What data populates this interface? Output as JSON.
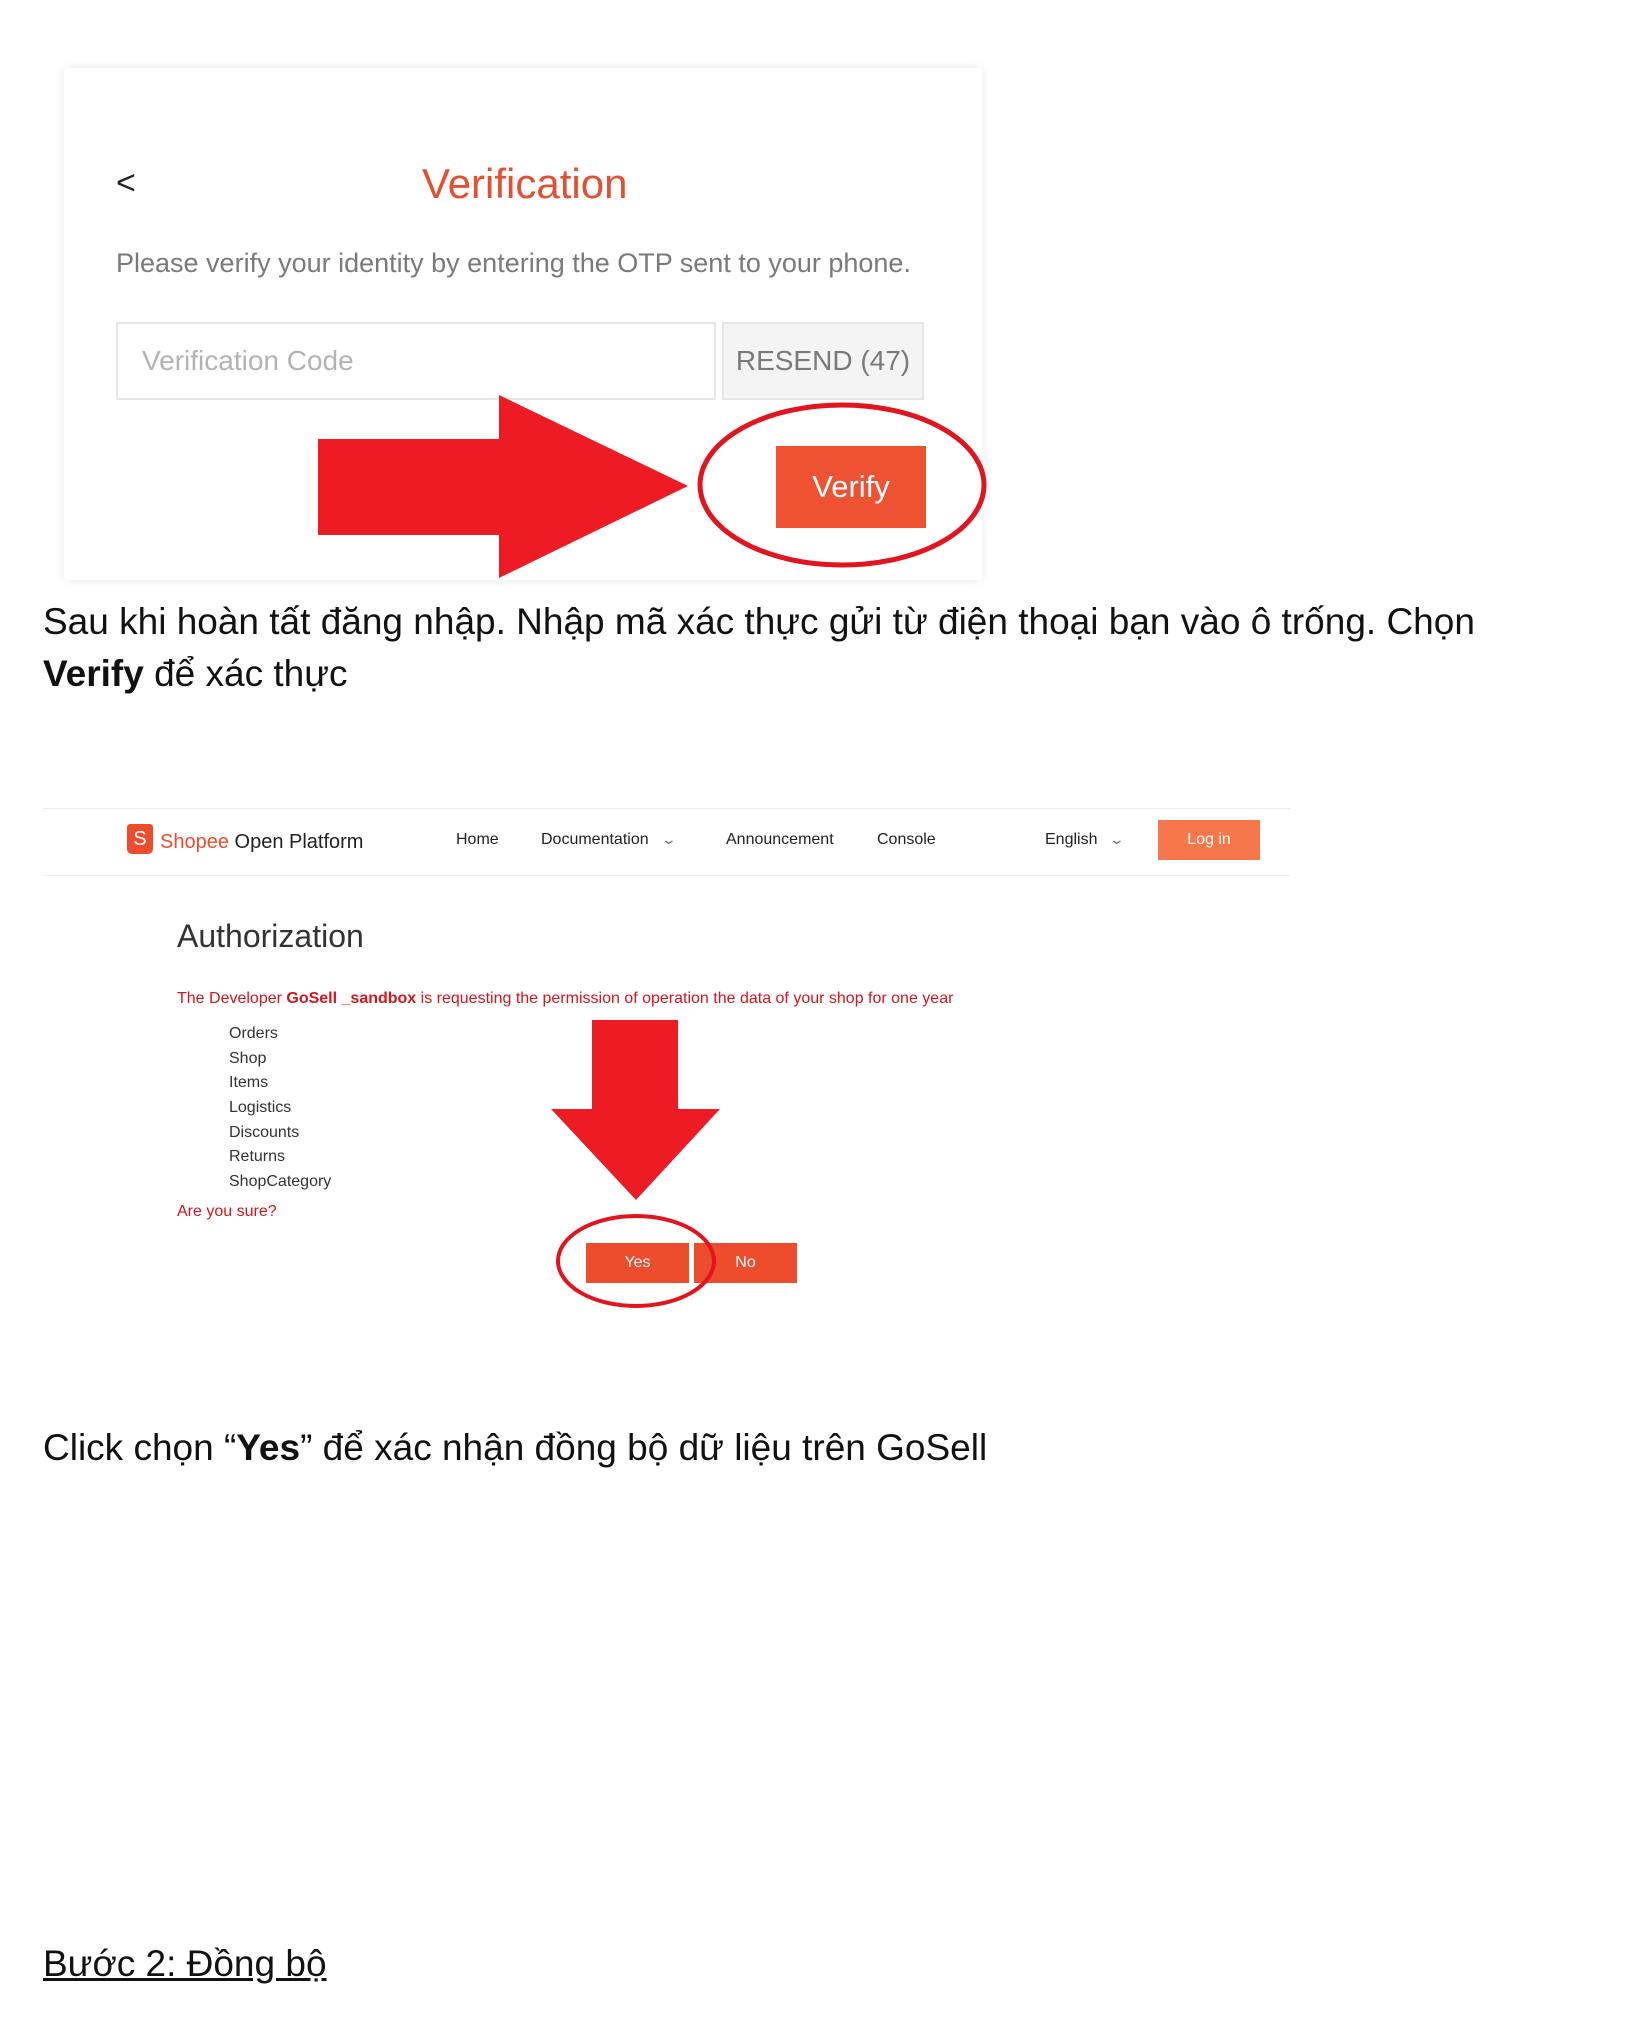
{
  "verification": {
    "back_icon": "<",
    "title": "Verification",
    "description": "Please verify your identity by entering the OTP sent to your phone.",
    "code_placeholder": "Verification Code",
    "resend_label": "RESEND (47)",
    "verify_label": "Verify",
    "accent_color": "#ef5233"
  },
  "caption1": {
    "text_before": "Sau khi hoàn tất đăng nhập. Nhập mã xác thực gửi từ điện thoại bạn vào ô trống. Chọn",
    "bold": "Verify",
    "text_after": " để xác thực"
  },
  "shopee": {
    "logo_letter": "S",
    "brand_name": "Shopee",
    "brand_suffix": " Open Platform",
    "nav": [
      "Home",
      "Documentation",
      "Announcement",
      "Console"
    ],
    "language": "English",
    "login_label": "Log in",
    "auth_title": "Authorization",
    "request_prefix": "The Developer ",
    "developer_name": "GoSell _sandbox",
    "request_suffix": " is requesting the permission of operation the data of your shop for one year",
    "permissions": [
      "Orders",
      "Shop",
      "Items",
      "Logistics",
      "Discounts",
      "Returns",
      "ShopCategory"
    ],
    "confirm_text": "Are you sure?",
    "yes_label": "Yes",
    "no_label": "No",
    "brand_color": "#ee4d2d"
  },
  "caption2": {
    "prefix": "Click chọn “",
    "bold": "Yes",
    "suffix": "” để xác nhận đồng bộ dữ liệu trên GoSell"
  },
  "step_heading": "Bước 2: Đồng bộ",
  "annotation_color": "#e3141d"
}
